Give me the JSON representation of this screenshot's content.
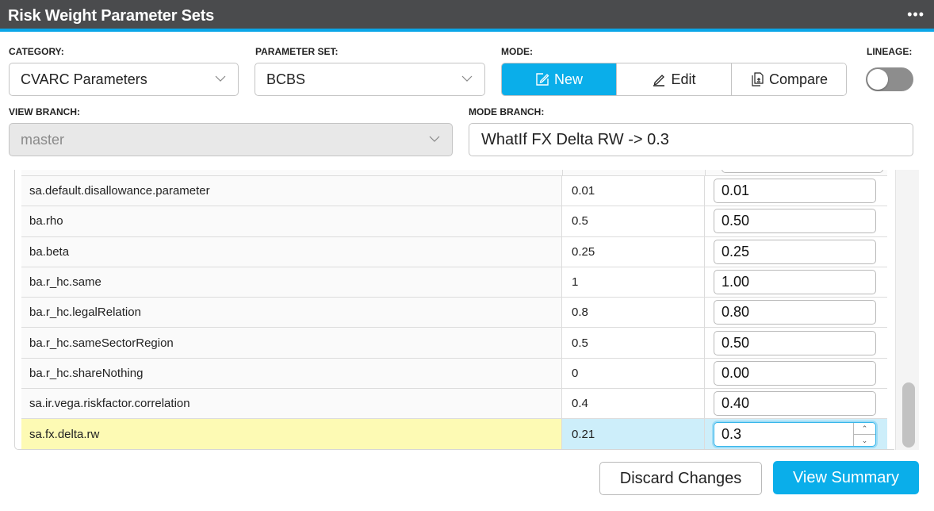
{
  "header": {
    "title": "Risk Weight Parameter Sets",
    "more_label": "•••"
  },
  "category": {
    "label": "CATEGORY:",
    "value": "CVARC Parameters"
  },
  "parameter_set": {
    "label": "PARAMETER SET:",
    "value": "BCBS"
  },
  "mode": {
    "label": "MODE:",
    "options": [
      {
        "label": "New",
        "icon": "edit-square-icon",
        "active": true
      },
      {
        "label": "Edit",
        "icon": "pencil-icon",
        "active": false
      },
      {
        "label": "Compare",
        "icon": "document-compare-icon",
        "active": false
      }
    ]
  },
  "lineage": {
    "label": "LINEAGE:",
    "enabled": false
  },
  "view_branch": {
    "label": "VIEW BRANCH:",
    "value": "master",
    "disabled": true
  },
  "mode_branch": {
    "label": "MODE BRANCH:",
    "value": "WhatIf FX Delta RW -> 0.3"
  },
  "table": {
    "rows": [
      {
        "name": "sa.default.disallowance.parameter",
        "current": "0.01",
        "new": "0.01"
      },
      {
        "name": "ba.rho",
        "current": "0.5",
        "new": "0.50"
      },
      {
        "name": "ba.beta",
        "current": "0.25",
        "new": "0.25"
      },
      {
        "name": "ba.r_hc.same",
        "current": "1",
        "new": "1.00"
      },
      {
        "name": "ba.r_hc.legalRelation",
        "current": "0.8",
        "new": "0.80"
      },
      {
        "name": "ba.r_hc.sameSectorRegion",
        "current": "0.5",
        "new": "0.50"
      },
      {
        "name": "ba.r_hc.shareNothing",
        "current": "0",
        "new": "0.00"
      },
      {
        "name": "sa.ir.vega.riskfactor.correlation",
        "current": "0.4",
        "new": "0.40"
      },
      {
        "name": "sa.fx.delta.rw",
        "current": "0.21",
        "new": "0.3",
        "highlighted": true
      }
    ]
  },
  "footer": {
    "discard_label": "Discard Changes",
    "summary_label": "View Summary"
  },
  "colors": {
    "accent": "#0aaeea",
    "header_bg": "#4a4b4d",
    "highlight_name": "#fdfab4",
    "highlight_value": "#cdeefa"
  }
}
